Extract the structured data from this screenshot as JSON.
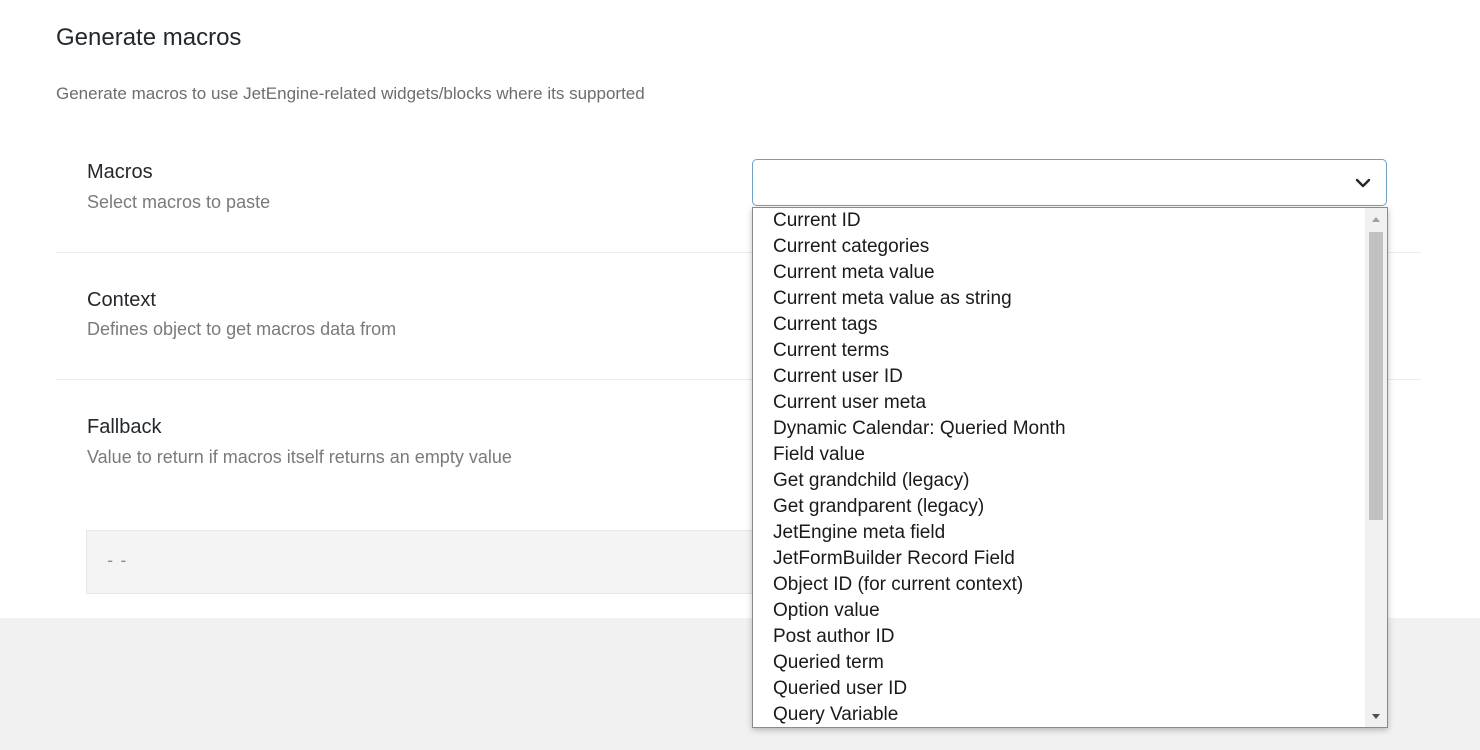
{
  "panel": {
    "title": "Generate macros",
    "description": "Generate macros to use JetEngine-related widgets/blocks where its supported"
  },
  "fields": {
    "macros": {
      "label": "Macros",
      "description": "Select macros to paste",
      "value": ""
    },
    "context": {
      "label": "Context",
      "description": "Defines object to get macros data from"
    },
    "fallback": {
      "label": "Fallback",
      "description": "Value to return if macros itself returns an empty value",
      "value": "--"
    }
  },
  "dropdown": {
    "options": [
      "Current ID",
      "Current categories",
      "Current meta value",
      "Current meta value as string",
      "Current tags",
      "Current terms",
      "Current user ID",
      "Current user meta",
      "Dynamic Calendar: Queried Month",
      "Field value",
      "Get grandchild (legacy)",
      "Get grandparent (legacy)",
      "JetEngine meta field",
      "JetFormBuilder Record Field",
      "Object ID (for current context)",
      "Option value",
      "Post author ID",
      "Queried term",
      "Queried user ID",
      "Query Variable"
    ],
    "scroll_position": 0.0
  },
  "icons": {
    "select_arrow": "chevron-down-icon",
    "scroll_up": "triangle-up-icon",
    "scroll_down": "triangle-down-icon"
  },
  "colors": {
    "focus_border": "#6fa1c4",
    "page_background": "#f1f1f1",
    "panel_background": "#ffffff"
  }
}
